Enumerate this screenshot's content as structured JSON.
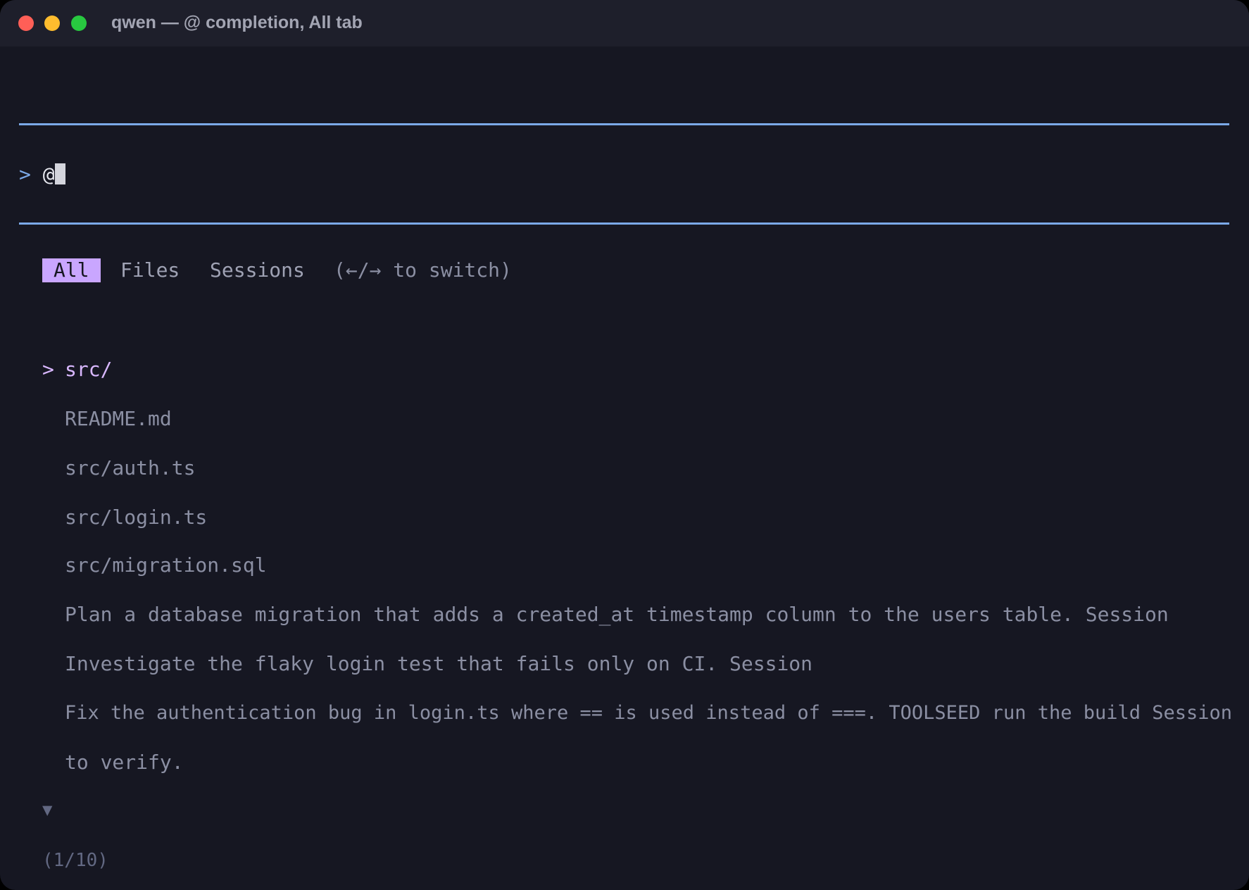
{
  "window": {
    "title": "qwen — @ completion, All tab"
  },
  "input": {
    "prompt_symbol": ">",
    "value": "@"
  },
  "tabs": {
    "items": [
      {
        "label": "All",
        "active": true
      },
      {
        "label": "Files",
        "active": false
      },
      {
        "label": "Sessions",
        "active": false
      }
    ],
    "hint": "(←/→ to switch)"
  },
  "completions": {
    "selected_marker": ">",
    "items": [
      {
        "text": "src/",
        "selected": true
      },
      {
        "text": "README.md",
        "selected": false
      },
      {
        "text": "src/auth.ts",
        "selected": false
      },
      {
        "text": "src/login.ts",
        "selected": false
      },
      {
        "text": "src/migration.sql",
        "selected": false
      },
      {
        "text": "Plan a database migration that adds a created_at timestamp column to the users table. Session",
        "selected": false
      },
      {
        "text": "Investigate the flaky login test that fails only on CI. Session",
        "selected": false
      },
      {
        "text": "Fix the authentication bug in login.ts where == is used instead of ===. TOOLSEED run the build Session",
        "selected": false
      },
      {
        "text": "to verify.",
        "selected": false
      }
    ],
    "more_indicator": "▼",
    "counter": "(1/10)"
  },
  "colors": {
    "background": "#161722",
    "titlebar": "#1e1f2b",
    "rule": "#7ba9e8",
    "accent": "#c9a6ff",
    "selected_text": "#d9b8ff",
    "muted_text": "#8b8fa3"
  }
}
